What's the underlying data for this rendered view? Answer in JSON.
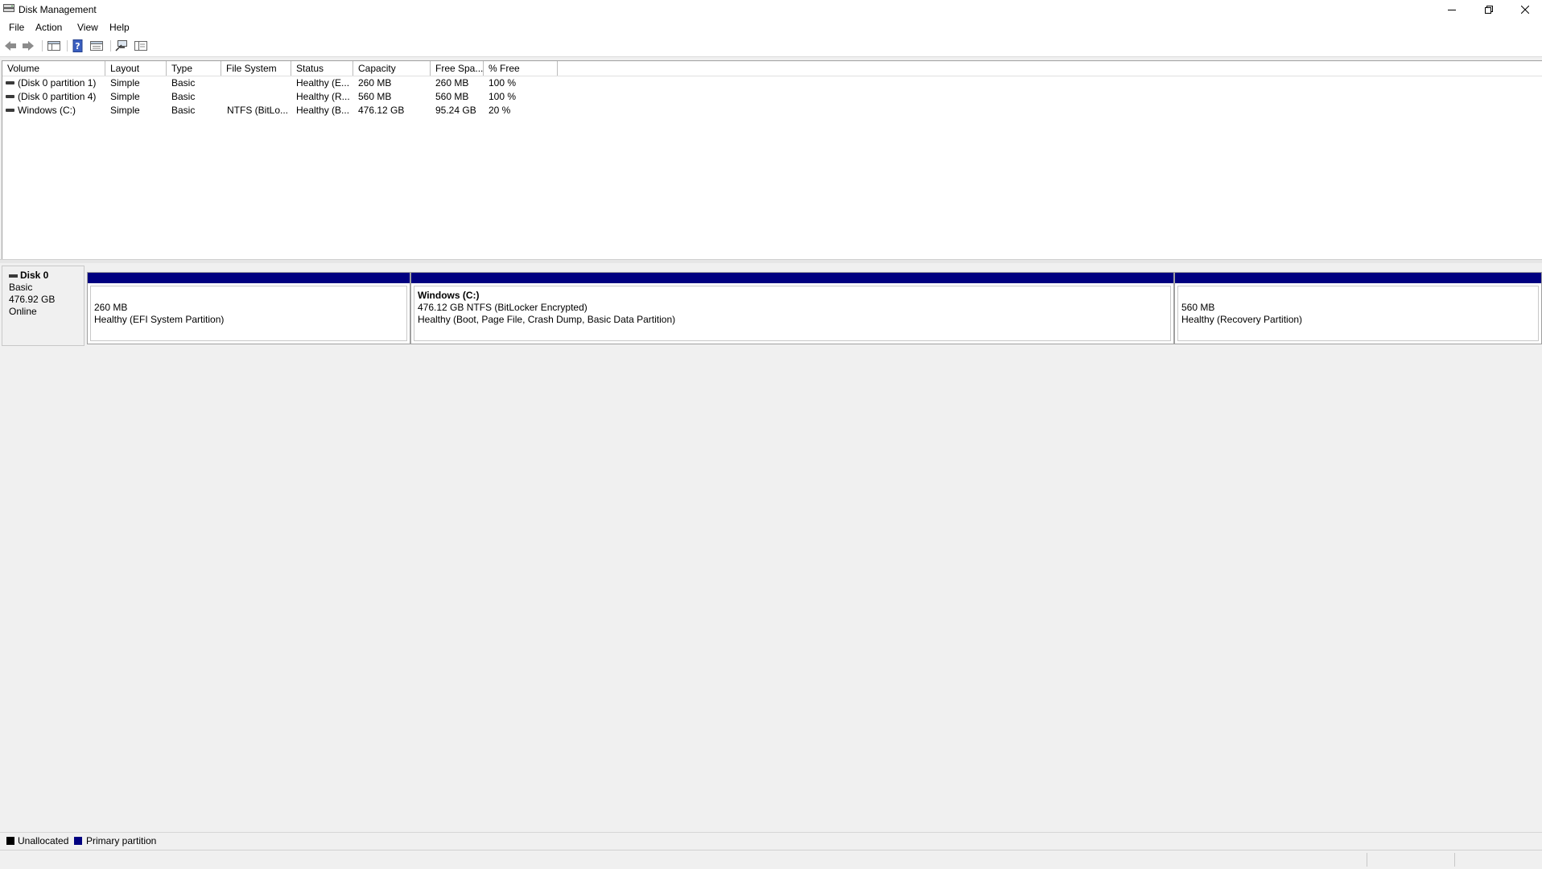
{
  "window": {
    "title": "Disk Management",
    "icon": "disk-management-icon",
    "controls": [
      "minimize-icon",
      "restore-icon",
      "close-icon"
    ]
  },
  "menu": {
    "items": [
      "File",
      "Action",
      "View",
      "Help"
    ]
  },
  "toolbar": {
    "buttons": [
      "back-arrow-icon",
      "forward-arrow-icon",
      "console-tree-icon",
      "help-icon",
      "properties-icon",
      "connect-icon",
      "view-pane-icon"
    ]
  },
  "volume_list": {
    "columns": [
      "Volume",
      "Layout",
      "Type",
      "File System",
      "Status",
      "Capacity",
      "Free Spa...",
      "% Free"
    ],
    "rows": [
      {
        "volume": "(Disk 0 partition 1)",
        "layout": "Simple",
        "type": "Basic",
        "file_system": "",
        "status": "Healthy (E...",
        "capacity": "260 MB",
        "free_space": "260 MB",
        "percent_free": "100 %"
      },
      {
        "volume": "(Disk 0 partition 4)",
        "layout": "Simple",
        "type": "Basic",
        "file_system": "",
        "status": "Healthy (R...",
        "capacity": "560 MB",
        "free_space": "560 MB",
        "percent_free": "100 %"
      },
      {
        "volume": "Windows (C:)",
        "layout": "Simple",
        "type": "Basic",
        "file_system": "NTFS (BitLo...",
        "status": "Healthy (B...",
        "capacity": "476.12 GB",
        "free_space": "95.24 GB",
        "percent_free": "20 %"
      }
    ]
  },
  "disks": [
    {
      "name": "Disk 0",
      "kind": "Basic",
      "size": "476.92 GB",
      "state": "Online",
      "partitions": [
        {
          "title": "",
          "line1": "260 MB",
          "line2": "Healthy (EFI System Partition)"
        },
        {
          "title": "Windows  (C:)",
          "line1": "476.12 GB NTFS (BitLocker Encrypted)",
          "line2": "Healthy (Boot, Page File, Crash Dump, Basic Data Partition)"
        },
        {
          "title": "",
          "line1": "560 MB",
          "line2": "Healthy (Recovery Partition)"
        }
      ]
    }
  ],
  "legend": {
    "items": [
      {
        "label": "Unallocated",
        "color": "#000000"
      },
      {
        "label": "Primary partition",
        "color": "#000080"
      }
    ]
  },
  "colors": {
    "primary_partition": "#000080",
    "unallocated": "#000000"
  }
}
